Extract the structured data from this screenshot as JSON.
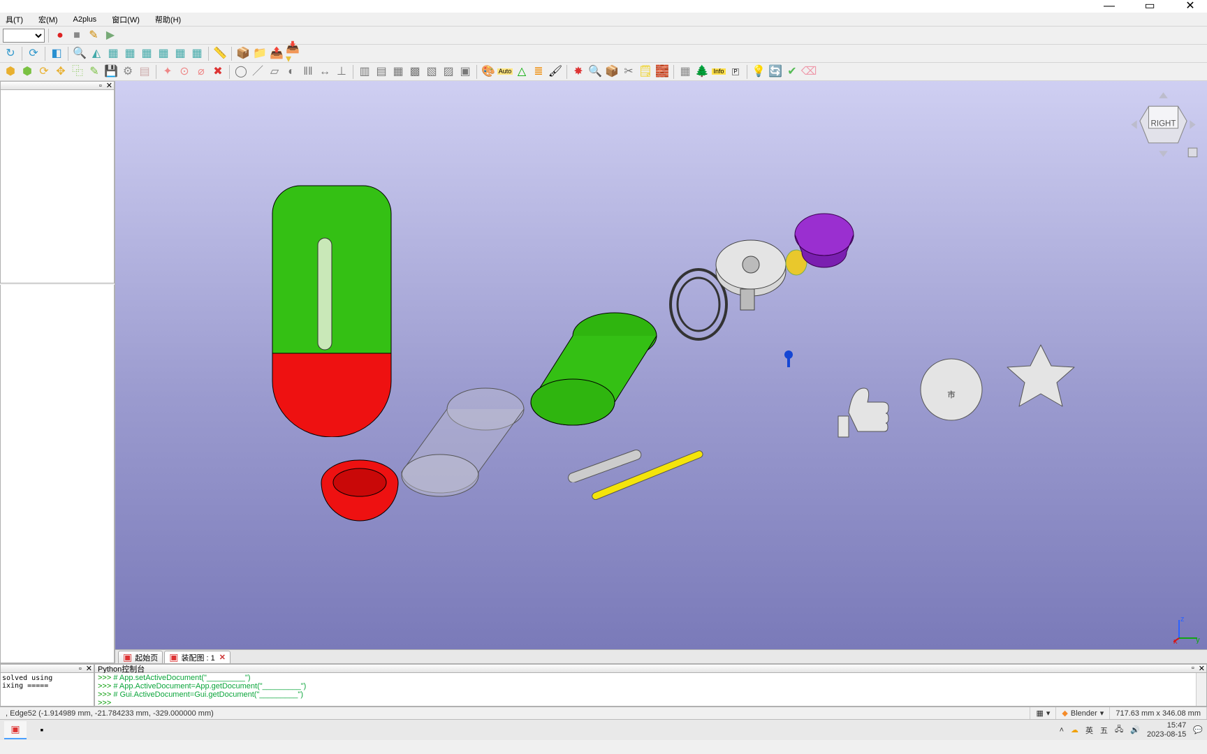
{
  "window": {
    "minimize_tip": "Minimize",
    "maximize_tip": "Restore",
    "close_tip": "Close"
  },
  "menu": {
    "items": [
      "具(T)",
      "宏(M)",
      "A2plus",
      "窗口(W)",
      "帮助(H)"
    ]
  },
  "toolbar1": {
    "combo_placeholder": ""
  },
  "left": {
    "tree_title": "",
    "prop_title": "",
    "float_tip": "float",
    "close_tip": "close"
  },
  "tabs": {
    "items": [
      {
        "label": "起始页",
        "closable": false
      },
      {
        "label": "装配图 : 1",
        "closable": true
      }
    ]
  },
  "navcube": {
    "face": "RIGHT"
  },
  "report": {
    "title": "",
    "text": "solved using\nixing ====="
  },
  "python": {
    "title": "Python控制台",
    "lines": [
      {
        "prompt": ">>> ",
        "code": "# App.setActiveDocument(\"_________\")"
      },
      {
        "prompt": ">>> ",
        "code": "# App.ActiveDocument=App.getDocument(\"_________\")"
      },
      {
        "prompt": ">>> ",
        "code": "# Gui.ActiveDocument=Gui.getDocument(\"_________\")"
      },
      {
        "prompt": ">>> ",
        "code": ""
      }
    ]
  },
  "status": {
    "preselect": ", Edge52 (-1.914989 mm, -21.784233 mm, -329.000000 mm)",
    "render_style": "▦",
    "workbench": "Blender",
    "dimensions": "717.63 mm x 346.08 mm"
  },
  "taskbar": {
    "ime_lang": "英",
    "ime_mode": "五",
    "time": "15:47",
    "date": "2023-08-15"
  }
}
